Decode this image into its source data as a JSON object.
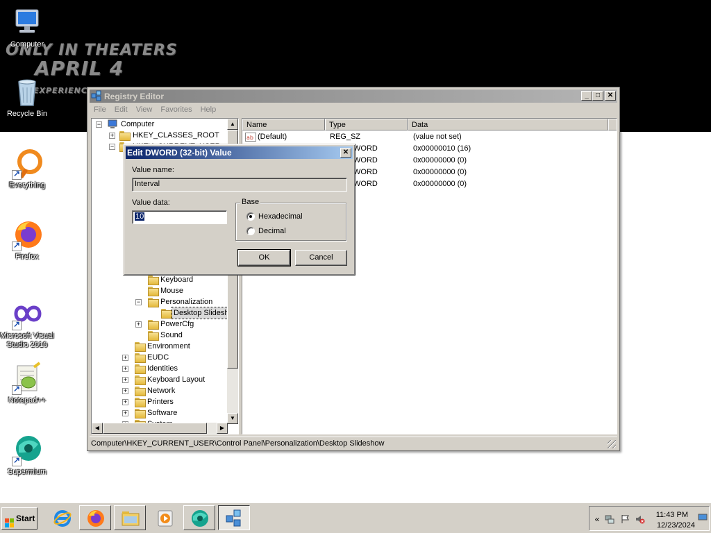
{
  "wallpaper": {
    "line1": "ONLY IN THEATERS",
    "line2": "APRIL 4",
    "line3": "EXPERIENCE IT IN IMAX"
  },
  "desktop_icons": [
    {
      "label": "Computer",
      "icon": "computer-icon"
    },
    {
      "label": "Recycle Bin",
      "icon": "recycle-bin-icon"
    },
    {
      "label": "Everything",
      "icon": "everything-icon"
    },
    {
      "label": "Firefox",
      "icon": "firefox-icon"
    },
    {
      "label": "Microsoft Visual Studio 2010",
      "icon": "visual-studio-icon"
    },
    {
      "label": "Notepad++",
      "icon": "notepad-plus-plus-icon"
    },
    {
      "label": "Supermium",
      "icon": "supermium-icon"
    }
  ],
  "regedit": {
    "title": "Registry Editor",
    "caption": {
      "minimize": "_",
      "maximize": "□",
      "close": "✕"
    },
    "menu": [
      "File",
      "Edit",
      "View",
      "Favorites",
      "Help"
    ],
    "tree": [
      {
        "label": "Computer",
        "expander": "−"
      },
      {
        "label": "HKEY_CLASSES_ROOT",
        "expander": "+"
      },
      {
        "label": "HKEY_CURRENT_USER",
        "expander": "−"
      },
      {
        "label": "Keyboard",
        "expander": ""
      },
      {
        "label": "Mouse",
        "expander": ""
      },
      {
        "label": "Personalization",
        "expander": "−"
      },
      {
        "label": "Desktop Slideshow",
        "expander": ""
      },
      {
        "label": "PowerCfg",
        "expander": "+"
      },
      {
        "label": "Sound",
        "expander": ""
      },
      {
        "label": "Environment",
        "expander": ""
      },
      {
        "label": "EUDC",
        "expander": "+"
      },
      {
        "label": "Identities",
        "expander": "+"
      },
      {
        "label": "Keyboard Layout",
        "expander": "+"
      },
      {
        "label": "Network",
        "expander": "+"
      },
      {
        "label": "Printers",
        "expander": "+"
      },
      {
        "label": "Software",
        "expander": "+"
      },
      {
        "label": "System",
        "expander": "+"
      }
    ],
    "columns": [
      "Name",
      "Type",
      "Data"
    ],
    "values": [
      {
        "name": "(Default)",
        "type": "REG_SZ",
        "data": "(value not set)",
        "icon": "string-value-icon"
      },
      {
        "name": "",
        "type": "WORD",
        "data": "0x00000010 (16)",
        "icon": "dword-value-icon"
      },
      {
        "name": "",
        "type": "WORD",
        "data": "0x00000000 (0)",
        "icon": "dword-value-icon"
      },
      {
        "name": "",
        "type": "WORD",
        "data": "0x00000000 (0)",
        "icon": "dword-value-icon"
      },
      {
        "name": "",
        "type": "WORD",
        "data": "0x00000000 (0)",
        "icon": "dword-value-icon"
      }
    ],
    "status_path": "Computer\\HKEY_CURRENT_USER\\Control Panel\\Personalization\\Desktop Slideshow"
  },
  "dialog": {
    "title": "Edit DWORD (32-bit) Value",
    "close": "✕",
    "value_name_label": "Value name:",
    "value_name": "Interval",
    "value_data_label": "Value data:",
    "value_data": "10",
    "base_label": "Base",
    "hex_label": "Hexadecimal",
    "dec_label": "Decimal",
    "base_selected": "Hexadecimal",
    "ok": "OK",
    "cancel": "Cancel"
  },
  "taskbar": {
    "start_label": "Start",
    "buttons": [
      {
        "icon": "internet-explorer-icon",
        "state": "normal"
      },
      {
        "icon": "firefox-icon",
        "state": "raised"
      },
      {
        "icon": "file-explorer-icon",
        "state": "raised"
      },
      {
        "icon": "media-player-icon",
        "state": "normal"
      },
      {
        "icon": "supermium-icon",
        "state": "raised"
      },
      {
        "icon": "registry-editor-icon",
        "state": "pressed"
      }
    ],
    "tray_expand": "«",
    "time": "11:43 PM",
    "date": "12/23/2024"
  },
  "colors": {
    "dialog_title": "#0a246a",
    "inactive_title": "#808080",
    "selection": "#0a246a",
    "face": "#d4d0c8"
  }
}
